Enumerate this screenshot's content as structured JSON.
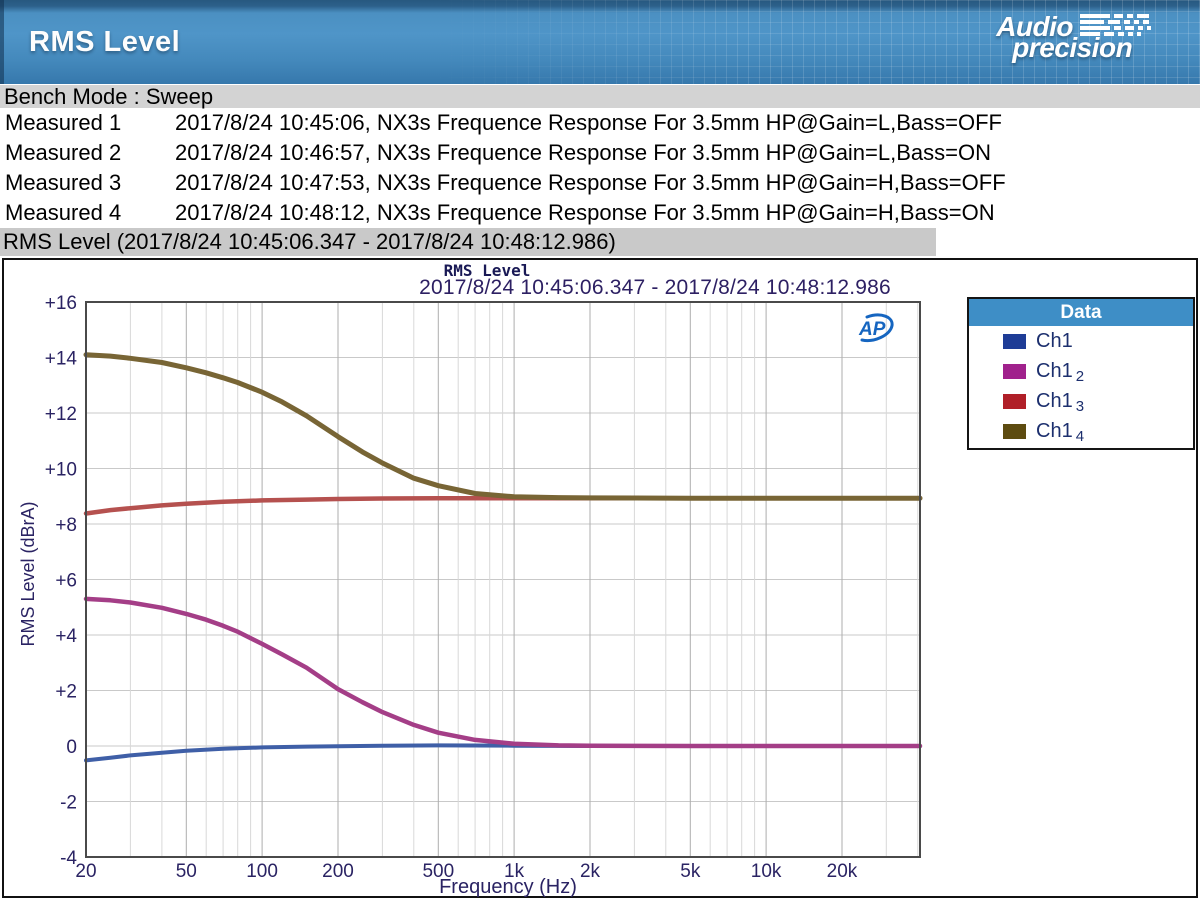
{
  "header": {
    "title": "RMS Level",
    "logo_line1": "Audio",
    "logo_line2": "precision"
  },
  "bench_bar": {
    "text": "Bench Mode : Sweep"
  },
  "measurements": [
    {
      "label": "Measured 1",
      "value": "2017/8/24 10:45:06, NX3s Frequence Response For 3.5mm HP@Gain=L,Bass=OFF"
    },
    {
      "label": "Measured 2",
      "value": "2017/8/24 10:46:57, NX3s Frequence Response For 3.5mm HP@Gain=L,Bass=ON"
    },
    {
      "label": "Measured 3",
      "value": "2017/8/24 10:47:53, NX3s Frequence Response For 3.5mm HP@Gain=H,Bass=OFF"
    },
    {
      "label": "Measured 4",
      "value": "2017/8/24 10:48:12, NX3s Frequence Response For 3.5mm HP@Gain=H,Bass=ON"
    }
  ],
  "section_bar": {
    "text": "RMS Level (2017/8/24 10:45:06.347 - 2017/8/24 10:48:12.986)"
  },
  "chart": {
    "title": "RMS Level",
    "subtitle": "2017/8/24 10:45:06.347 - 2017/8/24 10:48:12.986",
    "watermark": "AP",
    "legend": {
      "title": "Data",
      "entries": [
        {
          "label": "Ch1",
          "sub": ""
        },
        {
          "label": "Ch1",
          "sub": "2"
        },
        {
          "label": "Ch1",
          "sub": "3"
        },
        {
          "label": "Ch1",
          "sub": "4"
        }
      ]
    }
  },
  "chart_data": {
    "type": "line",
    "xscale": "log",
    "title": "RMS Level",
    "subtitle": "2017/8/24 10:45:06.347 - 2017/8/24 10:48:12.986",
    "xlabel": "Frequency (Hz)",
    "ylabel": "RMS Level (dBrA)",
    "xlim": [
      20,
      40800
    ],
    "ylim": [
      -4,
      16
    ],
    "ytick_step": 2,
    "yticks": [
      {
        "v": 16,
        "l": "+16"
      },
      {
        "v": 14,
        "l": "+14"
      },
      {
        "v": 12,
        "l": "+12"
      },
      {
        "v": 10,
        "l": "+10"
      },
      {
        "v": 8,
        "l": "+8"
      },
      {
        "v": 6,
        "l": "+6"
      },
      {
        "v": 4,
        "l": "+4"
      },
      {
        "v": 2,
        "l": "+2"
      },
      {
        "v": 0,
        "l": "0"
      },
      {
        "v": -2,
        "l": "-2"
      },
      {
        "v": -4,
        "l": "-4"
      }
    ],
    "xticks": [
      {
        "v": 20,
        "l": "20"
      },
      {
        "v": 50,
        "l": "50"
      },
      {
        "v": 100,
        "l": "100"
      },
      {
        "v": 200,
        "l": "200"
      },
      {
        "v": 500,
        "l": "500"
      },
      {
        "v": 1000,
        "l": "1k"
      },
      {
        "v": 2000,
        "l": "2k"
      },
      {
        "v": 5000,
        "l": "5k"
      },
      {
        "v": 10000,
        "l": "10k"
      },
      {
        "v": 20000,
        "l": "20k"
      }
    ],
    "x_minor": [
      30,
      40,
      60,
      70,
      80,
      90,
      300,
      400,
      600,
      700,
      800,
      900,
      3000,
      4000,
      6000,
      7000,
      8000,
      9000,
      30000,
      40000
    ],
    "colors": {
      "grid_minor": "#d8d8d8",
      "grid_major": "#aeaeae",
      "grid_h": "#c9c9c9",
      "frame": "#4a4a4a",
      "text": "#2a2363",
      "legend_header_bg": "#3e8ec6",
      "watermark_blue": "#1565c0"
    },
    "series": [
      {
        "name": "Ch1",
        "color": "#3f5fa7",
        "swatch": "#1e3c96",
        "width": 4,
        "points": [
          [
            20,
            -0.52
          ],
          [
            25,
            -0.42
          ],
          [
            30,
            -0.34
          ],
          [
            40,
            -0.24
          ],
          [
            50,
            -0.17
          ],
          [
            70,
            -0.1
          ],
          [
            100,
            -0.05
          ],
          [
            150,
            -0.02
          ],
          [
            200,
            -0.01
          ],
          [
            300,
            0.01
          ],
          [
            500,
            0.02
          ],
          [
            1000,
            0.01
          ],
          [
            2000,
            0
          ],
          [
            5000,
            0
          ],
          [
            10000,
            0
          ],
          [
            20000,
            0
          ],
          [
            40800,
            0
          ]
        ]
      },
      {
        "name": "Ch1 2",
        "color": "#a43e87",
        "swatch": "#a0218c",
        "width": 4.5,
        "points": [
          [
            20,
            5.3
          ],
          [
            25,
            5.25
          ],
          [
            30,
            5.17
          ],
          [
            40,
            4.98
          ],
          [
            50,
            4.76
          ],
          [
            60,
            4.55
          ],
          [
            70,
            4.33
          ],
          [
            80,
            4.12
          ],
          [
            100,
            3.68
          ],
          [
            120,
            3.3
          ],
          [
            150,
            2.82
          ],
          [
            200,
            2.05
          ],
          [
            250,
            1.58
          ],
          [
            300,
            1.22
          ],
          [
            400,
            0.76
          ],
          [
            500,
            0.48
          ],
          [
            700,
            0.22
          ],
          [
            1000,
            0.08
          ],
          [
            1500,
            0.02
          ],
          [
            2000,
            0.01
          ],
          [
            5000,
            0
          ],
          [
            10000,
            0
          ],
          [
            20000,
            0
          ],
          [
            40800,
            0
          ]
        ]
      },
      {
        "name": "Ch1 3",
        "color": "#b5514f",
        "swatch": "#b01f28",
        "width": 4.5,
        "points": [
          [
            20,
            8.38
          ],
          [
            25,
            8.5
          ],
          [
            30,
            8.57
          ],
          [
            40,
            8.67
          ],
          [
            50,
            8.73
          ],
          [
            70,
            8.8
          ],
          [
            100,
            8.85
          ],
          [
            150,
            8.88
          ],
          [
            200,
            8.9
          ],
          [
            300,
            8.92
          ],
          [
            500,
            8.93
          ],
          [
            1000,
            8.93
          ],
          [
            2000,
            8.93
          ],
          [
            5000,
            8.93
          ],
          [
            10000,
            8.93
          ],
          [
            20000,
            8.93
          ],
          [
            40800,
            8.93
          ]
        ]
      },
      {
        "name": "Ch1 4",
        "color": "#786535",
        "swatch": "#5d4b10",
        "width": 5,
        "points": [
          [
            20,
            14.1
          ],
          [
            25,
            14.05
          ],
          [
            30,
            13.97
          ],
          [
            40,
            13.82
          ],
          [
            50,
            13.63
          ],
          [
            60,
            13.45
          ],
          [
            70,
            13.27
          ],
          [
            80,
            13.1
          ],
          [
            100,
            12.75
          ],
          [
            120,
            12.4
          ],
          [
            150,
            11.9
          ],
          [
            200,
            11.15
          ],
          [
            250,
            10.6
          ],
          [
            300,
            10.2
          ],
          [
            400,
            9.65
          ],
          [
            500,
            9.38
          ],
          [
            700,
            9.1
          ],
          [
            1000,
            8.98
          ],
          [
            1500,
            8.95
          ],
          [
            2000,
            8.94
          ],
          [
            5000,
            8.93
          ],
          [
            10000,
            8.93
          ],
          [
            20000,
            8.93
          ],
          [
            40800,
            8.93
          ]
        ]
      }
    ],
    "legend_position": "right"
  }
}
